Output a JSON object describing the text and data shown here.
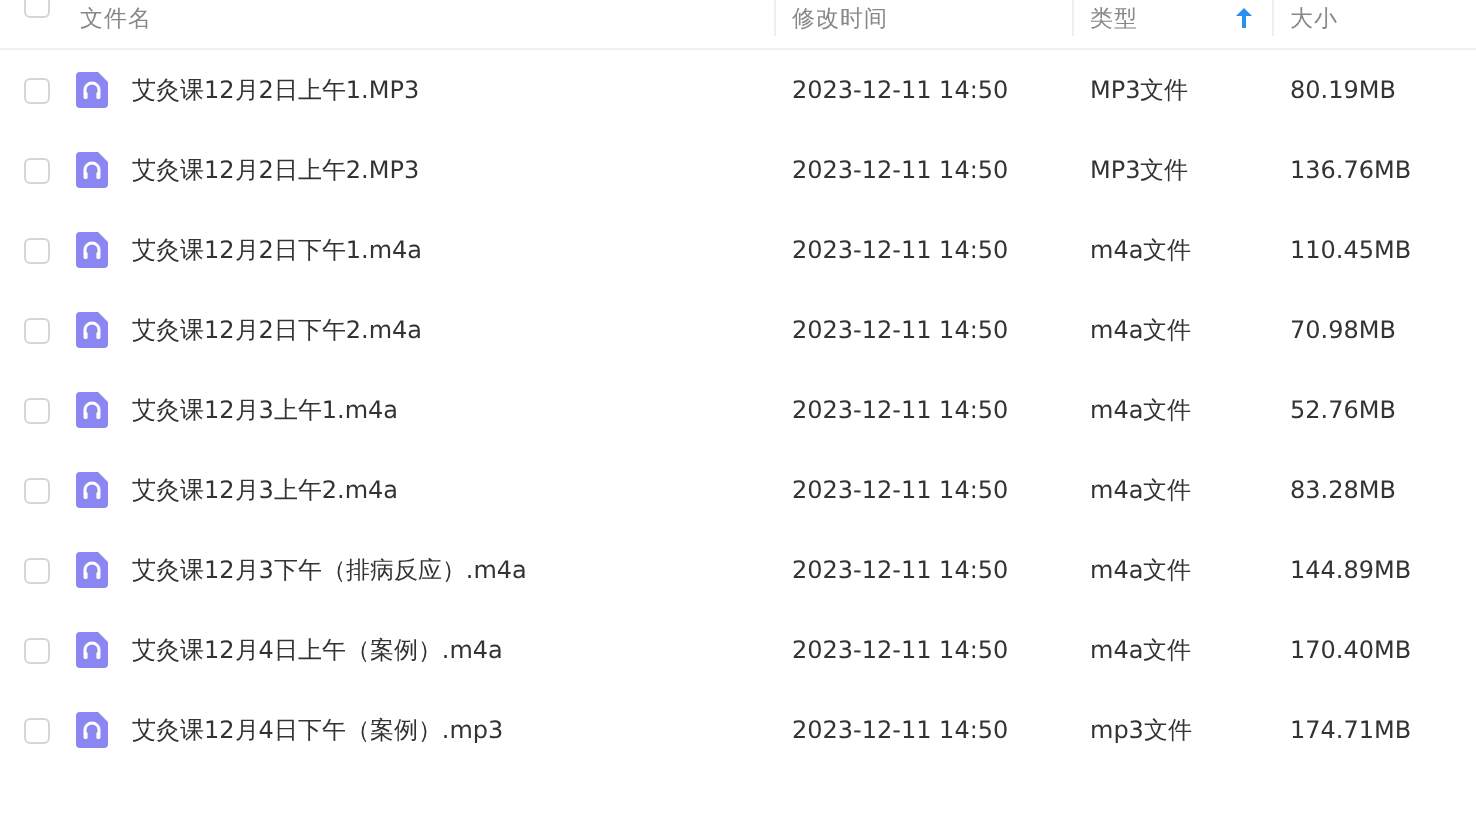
{
  "table": {
    "select_all": {
      "checked": false
    },
    "columns": [
      {
        "label": "文件名",
        "sorted": false
      },
      {
        "label": "修改时间",
        "sorted": false
      },
      {
        "label": "类型",
        "sorted": true
      },
      {
        "label": "大小",
        "sorted": false
      }
    ],
    "rows": [
      {
        "name": "艾灸课12月2日上午1.MP3",
        "modified": "2023-12-11 14:50",
        "type": "MP3文件",
        "size": "80.19MB",
        "checked": false
      },
      {
        "name": "艾灸课12月2日上午2.MP3",
        "modified": "2023-12-11 14:50",
        "type": "MP3文件",
        "size": "136.76MB",
        "checked": false
      },
      {
        "name": "艾灸课12月2日下午1.m4a",
        "modified": "2023-12-11 14:50",
        "type": "m4a文件",
        "size": "110.45MB",
        "checked": false
      },
      {
        "name": "艾灸课12月2日下午2.m4a",
        "modified": "2023-12-11 14:50",
        "type": "m4a文件",
        "size": "70.98MB",
        "checked": false
      },
      {
        "name": "艾灸课12月3上午1.m4a",
        "modified": "2023-12-11 14:50",
        "type": "m4a文件",
        "size": "52.76MB",
        "checked": false
      },
      {
        "name": "艾灸课12月3上午2.m4a",
        "modified": "2023-12-11 14:50",
        "type": "m4a文件",
        "size": "83.28MB",
        "checked": false
      },
      {
        "name": "艾灸课12月3下午（排病反应）.m4a",
        "modified": "2023-12-11 14:50",
        "type": "m4a文件",
        "size": "144.89MB",
        "checked": false
      },
      {
        "name": "艾灸课12月4日上午（案例）.m4a",
        "modified": "2023-12-11 14:50",
        "type": "m4a文件",
        "size": "170.40MB",
        "checked": false
      },
      {
        "name": "艾灸课12月4日下午（案例）.mp3",
        "modified": "2023-12-11 14:50",
        "type": "mp3文件",
        "size": "174.71MB",
        "checked": false
      }
    ]
  }
}
